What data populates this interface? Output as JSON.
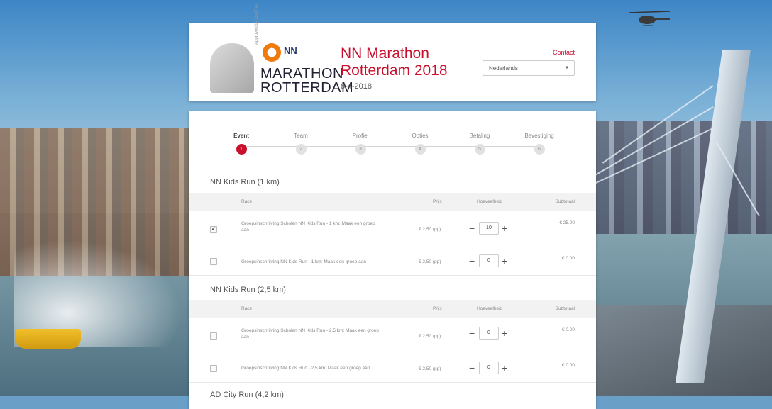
{
  "header": {
    "logo_nn": "NN",
    "logo_line1": "MARATHON",
    "logo_line2": "ROTTERDAM",
    "logo_sub": "Approved by LikeThat",
    "event_title": "NN Marathon Rotterdam 2018",
    "event_date": "8-4-2018",
    "contact_label": "Contact",
    "language_selected": "Nederlands",
    "accent_color": "#c8102e",
    "nn_orange": "#f07b0c"
  },
  "steps": [
    {
      "label": "Event",
      "number": "1",
      "active": true
    },
    {
      "label": "Team",
      "number": "2",
      "active": false
    },
    {
      "label": "Profiel",
      "number": "3",
      "active": false
    },
    {
      "label": "Opties",
      "number": "4",
      "active": false
    },
    {
      "label": "Betaling",
      "number": "5",
      "active": false
    },
    {
      "label": "Bevestiging",
      "number": "6",
      "active": false
    }
  ],
  "columns": {
    "race": "Race",
    "price": "Prijs",
    "quantity": "Hoeveelheid",
    "subtotal": "Subtotaal"
  },
  "sections": [
    {
      "title": "NN Kids Run (1 km)",
      "rows": [
        {
          "checked": true,
          "name": "Groepsinschrijving Scholen NN Kids Run - 1 km: Maak een groep aan",
          "price": "€ 2,50 (pp)",
          "quantity": "10",
          "subtotal": "€ 25.00"
        },
        {
          "checked": false,
          "name": "Groepsinschrijving NN Kids Run - 1 km: Maak een groep aan",
          "price": "€ 2,50 (pp)",
          "quantity": "0",
          "subtotal": "€ 0.00"
        }
      ]
    },
    {
      "title": "NN Kids Run (2,5 km)",
      "rows": [
        {
          "checked": false,
          "name": "Groepsinschrijving Scholen NN Kids Run - 2,5 km: Maak een groep aan",
          "price": "€ 2,50 (pp)",
          "quantity": "0",
          "subtotal": "€ 0.00"
        },
        {
          "checked": false,
          "name": "Groepsinschrijving NN Kids Run - 2,5 km: Maak een groep aan",
          "price": "€ 2,50 (pp)",
          "quantity": "0",
          "subtotal": "€ 0.00"
        }
      ]
    },
    {
      "title": "AD City Run (4,2 km)",
      "rows": []
    }
  ],
  "qty_minus": "−",
  "qty_plus": "+",
  "check_mark": "✔"
}
